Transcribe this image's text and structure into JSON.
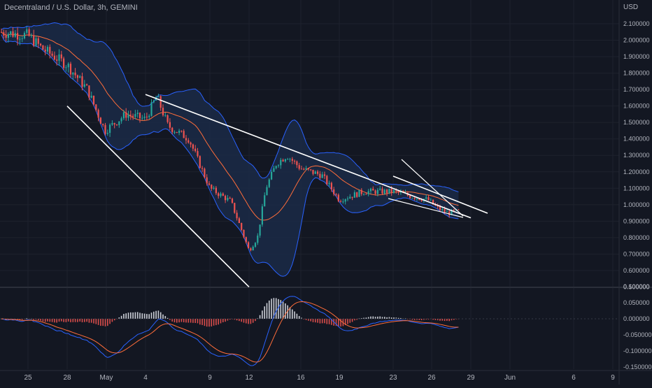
{
  "header": {
    "title": "Decentraland / U.S. Dollar, 3h, GEMINI",
    "currency": "USD"
  },
  "colors": {
    "background": "#131722",
    "grid": "#1e222d",
    "up": "#26a69a",
    "down": "#ef5350",
    "band_fill": "#1b2a47",
    "band_line": "#2962ff",
    "basis": "#ff6d3a",
    "trendline": "#ffffff",
    "macd_line": "#2962ff",
    "signal_line": "#ff6d3a",
    "axis_text": "#b2b5be"
  },
  "chart_data": [
    {
      "type": "candlestick",
      "title": "Decentraland / U.S. Dollar, 3h, GEMINI",
      "ylabel": "USD",
      "ylim": [
        0.45,
        2.2
      ],
      "y_ticks": [
        "2.100000",
        "2.000000",
        "1.900000",
        "1.800000",
        "1.700000",
        "1.600000",
        "1.500000",
        "1.400000",
        "1.300000",
        "1.200000",
        "1.100000",
        "1.000000",
        "0.900000",
        "0.800000",
        "0.700000",
        "0.600000",
        "0.500000"
      ],
      "x_ticks": [
        "25",
        "28",
        "May",
        "4",
        "9",
        "12",
        "16",
        "19",
        "23",
        "26",
        "29",
        "Jun",
        "6",
        "9"
      ],
      "overlays": [
        "Bollinger Bands (upper, basis, lower)",
        "trendlines"
      ],
      "close_approx": [
        {
          "x": "25",
          "y": 2.03
        },
        {
          "x": "28",
          "y": 1.85
        },
        {
          "x": "May",
          "y": 1.45
        },
        {
          "x": "4",
          "y": 1.52
        },
        {
          "x": "9",
          "y": 1.05
        },
        {
          "x": "12",
          "y": 0.72
        },
        {
          "x": "16",
          "y": 1.22
        },
        {
          "x": "19",
          "y": 1.03
        },
        {
          "x": "23",
          "y": 1.08
        },
        {
          "x": "26",
          "y": 1.02
        },
        {
          "x": "29",
          "y": 0.96
        }
      ],
      "trendlines": [
        {
          "from": {
            "x": "4",
            "y": 1.67
          },
          "to": {
            "x": "29",
            "y": 0.92
          }
        },
        {
          "from": {
            "x": "28",
            "y": 1.6
          },
          "to": {
            "x": "12",
            "y": 0.5
          }
        }
      ]
    },
    {
      "type": "histogram",
      "title": "",
      "ylabel": "",
      "ylim": [
        -0.16,
        0.105
      ],
      "y_ticks": [
        "0.100000",
        "0.050000",
        "0.000000",
        "-0.050000",
        "-0.100000",
        "-0.150000"
      ],
      "series": [
        {
          "name": "",
          "values_approx": [
            0.0,
            -0.01,
            -0.04,
            0.01,
            -0.07,
            -0.11,
            0.07,
            0.02,
            0.005,
            -0.01,
            -0.005
          ]
        }
      ]
    }
  ]
}
